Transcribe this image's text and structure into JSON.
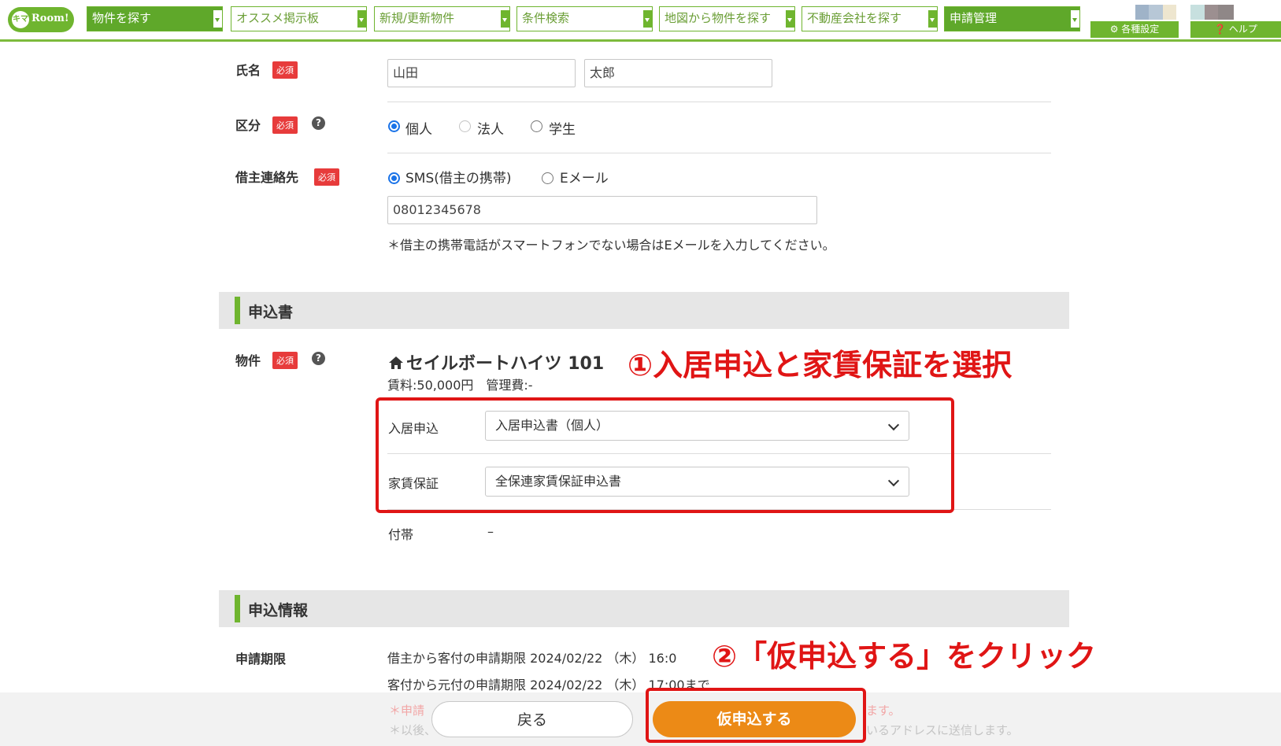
{
  "header": {
    "logo_mark": "キマ",
    "logo_text": "Room!",
    "nav": [
      {
        "label": "物件を探す"
      },
      {
        "label": "オススメ掲示板"
      },
      {
        "label": "新規/更新物件"
      },
      {
        "label": "条件検索"
      },
      {
        "label": "地図から物件を探す"
      },
      {
        "label": "不動産会社を探す"
      },
      {
        "label": "申請管理"
      }
    ],
    "settings_label": "各種設定",
    "help_label": "ヘルプ",
    "swatch_colors": [
      "#9fb3c8",
      "#b7c7d6",
      "#eee6cf",
      "#c7e0df",
      "#9c8f90",
      "#8f8787"
    ]
  },
  "form": {
    "required_badge": "必須",
    "help_glyph": "?",
    "name": {
      "label": "氏名",
      "last_name": "山田",
      "first_name": "太郎"
    },
    "category": {
      "label": "区分",
      "options": [
        "個人",
        "法人",
        "学生"
      ],
      "selected": "個人"
    },
    "contact": {
      "label": "借主連絡先",
      "options": [
        "SMS(借主の携帯)",
        "Eメール"
      ],
      "selected": "SMS(借主の携帯)",
      "phone": "08012345678",
      "note": "＊借主の携帯電話がスマートフォンでない場合はEメールを入力してください。"
    }
  },
  "application_section": {
    "title": "申込書",
    "property_label": "物件",
    "property_name": "セイルボートハイツ 101",
    "rent_line": "賃料:50,000円　管理費:-",
    "move_in": {
      "label": "入居申込",
      "value": "入居申込書（個人）"
    },
    "guarantee": {
      "label": "家賃保証",
      "value": "全保連家賃保証申込書"
    },
    "incidental": {
      "label": "付帯",
      "value": "–"
    }
  },
  "info_section": {
    "title": "申込情報",
    "deadline_label": "申請期限",
    "deadline_line1": "借主から客付の申請期限 2024/02/22 （木） 16:0",
    "deadline_line2": "客付から元付の申請期限 2024/02/22 （木） 17:00まで",
    "notice1_start": "＊申請",
    "notice1_end": "ます。",
    "notice2_start": "＊以後、",
    "notice2_end": "いるアドレスに送信します。"
  },
  "annotations": {
    "step1": "①入居申込と家賃保証を選択",
    "step2": "②「仮申込する」をクリック"
  },
  "footer": {
    "back_label": "戻る",
    "apply_label": "仮申込する"
  }
}
